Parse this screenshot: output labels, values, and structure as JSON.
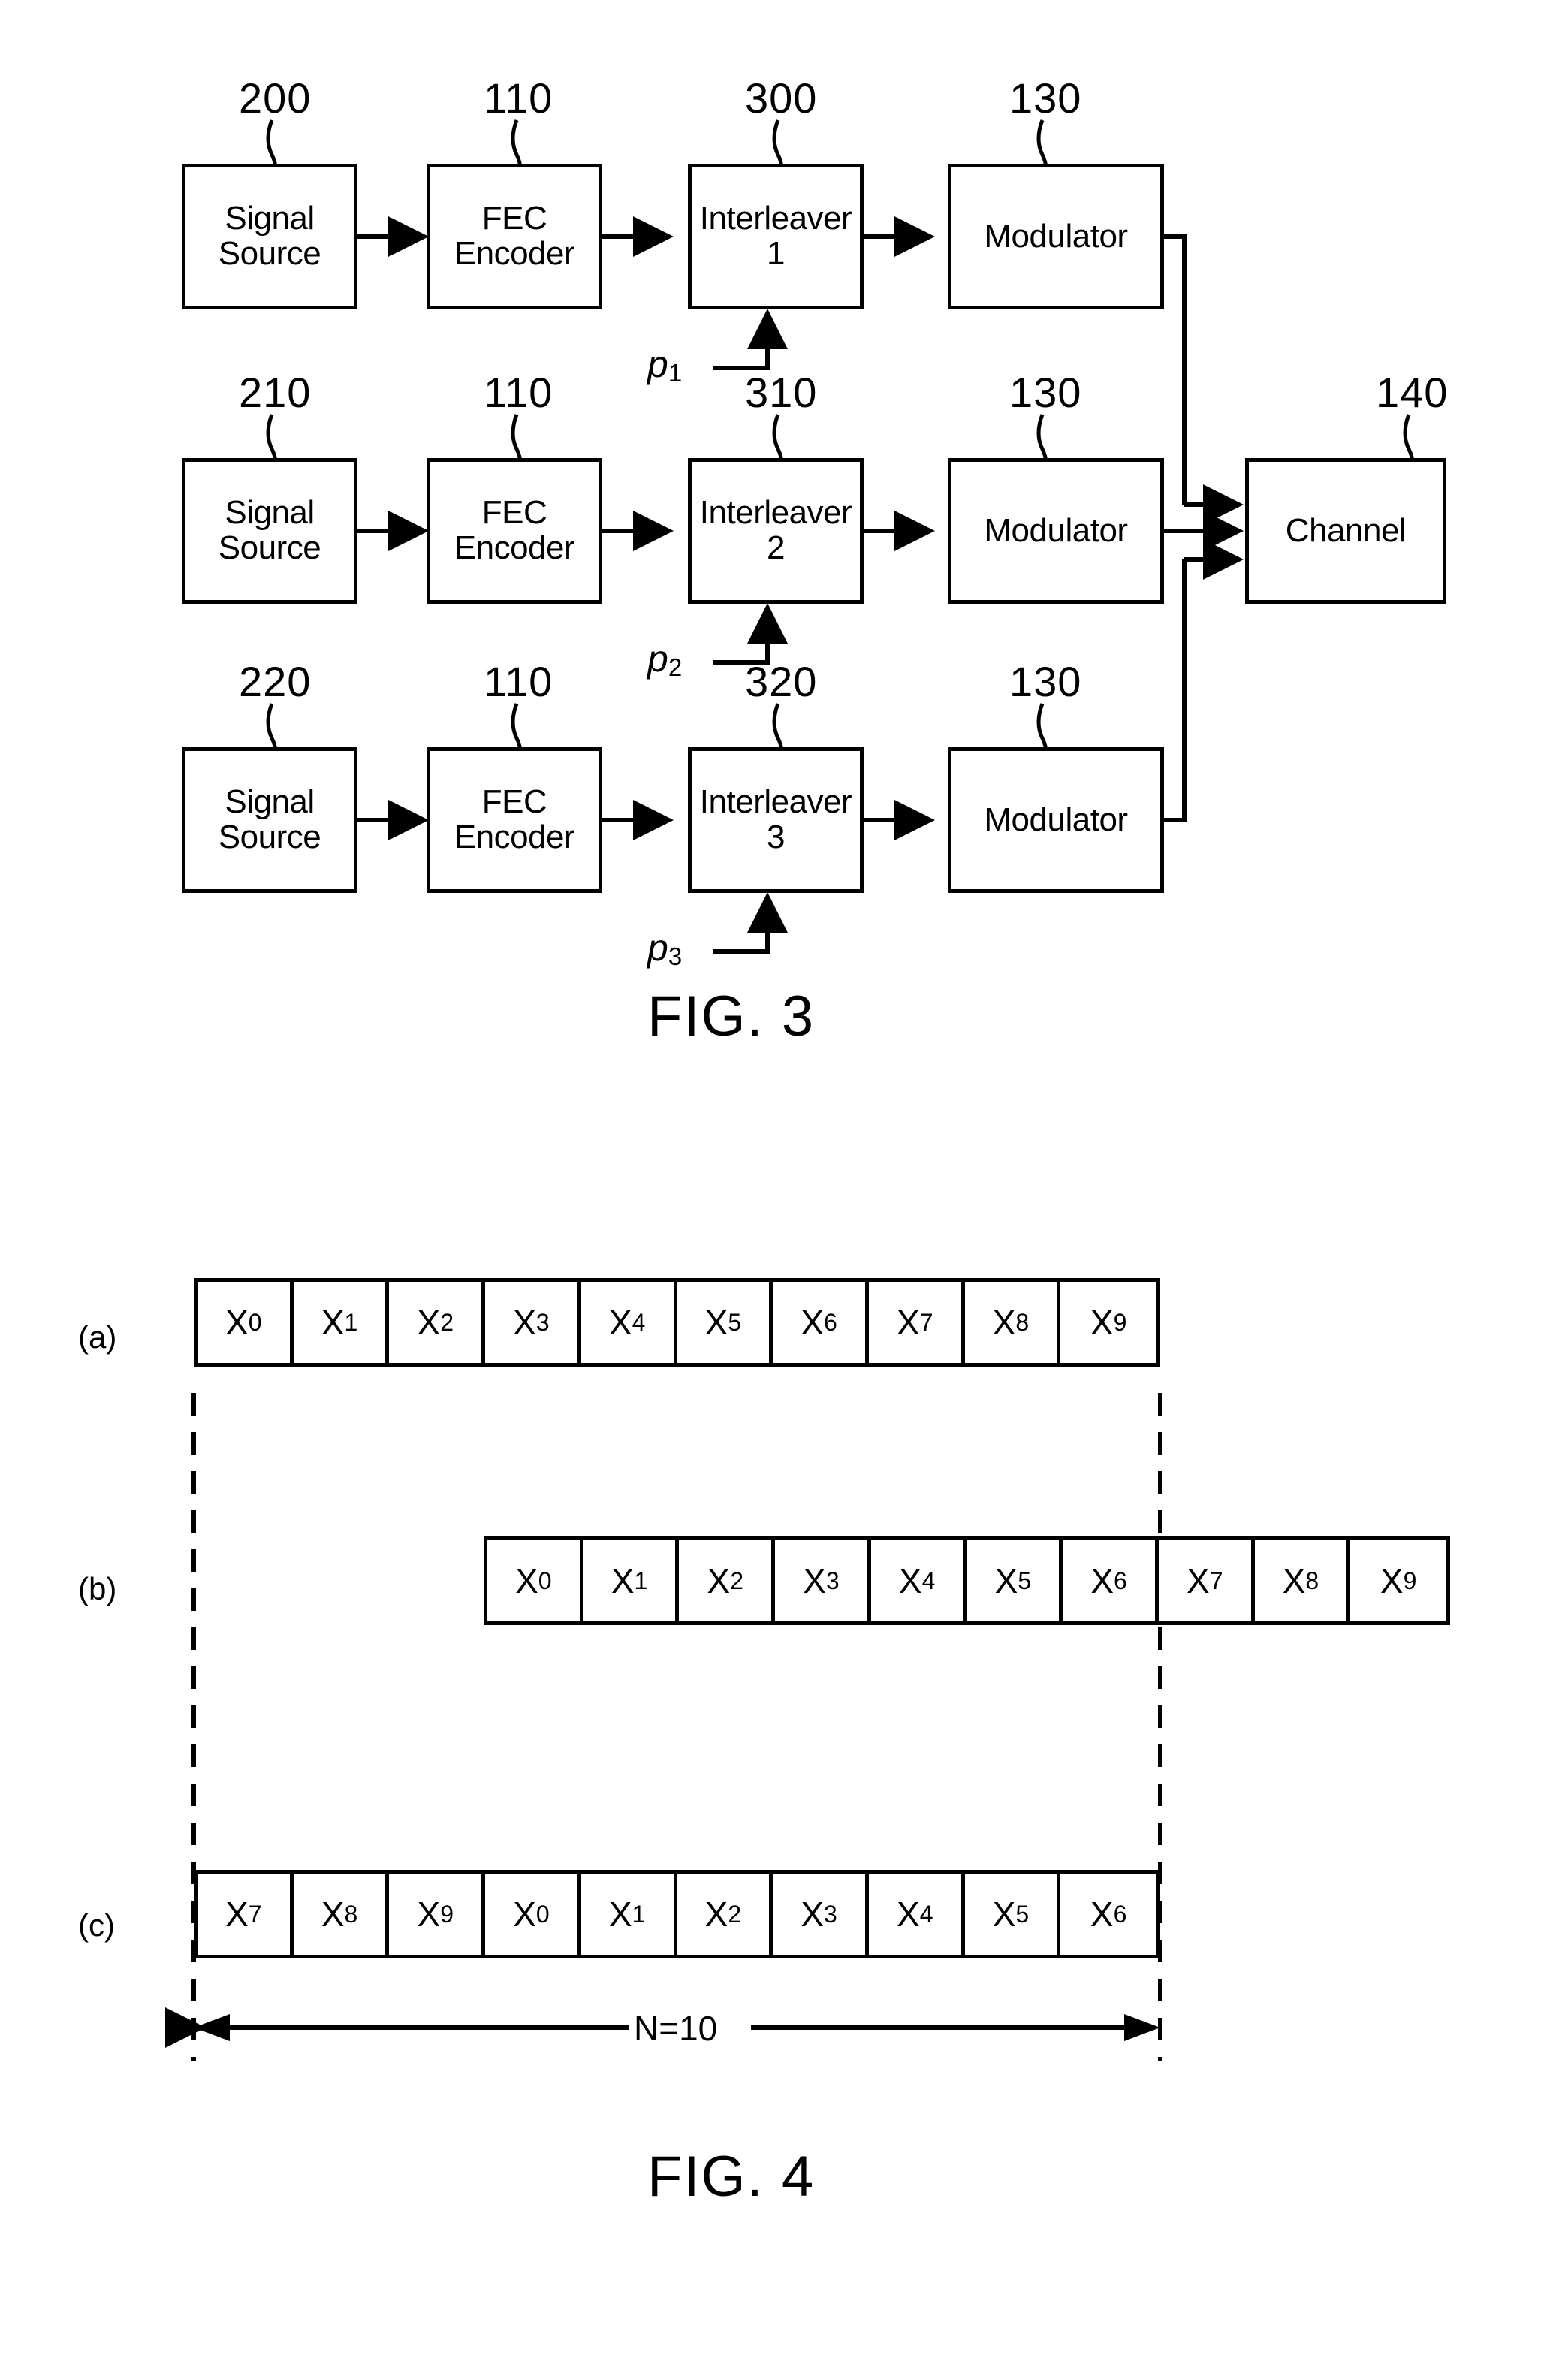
{
  "figure3": {
    "caption": "FIG. 3",
    "rows": [
      {
        "source_ref": "200",
        "source_label_line1": "Signal",
        "source_label_line2": "Source",
        "encoder_ref": "110",
        "encoder_label_line1": "FEC",
        "encoder_label_line2": "Encoder",
        "interleaver_ref": "300",
        "interleaver_label_line1": "Interleaver",
        "interleaver_label_line2": "1",
        "modulator_ref": "130",
        "modulator_label": "Modulator",
        "permutation_label": "p",
        "permutation_sub": "1"
      },
      {
        "source_ref": "210",
        "source_label_line1": "Signal",
        "source_label_line2": "Source",
        "encoder_ref": "110",
        "encoder_label_line1": "FEC",
        "encoder_label_line2": "Encoder",
        "interleaver_ref": "310",
        "interleaver_label_line1": "Interleaver",
        "interleaver_label_line2": "2",
        "modulator_ref": "130",
        "modulator_label": "Modulator",
        "permutation_label": "p",
        "permutation_sub": "2"
      },
      {
        "source_ref": "220",
        "source_label_line1": "Signal",
        "source_label_line2": "Source",
        "encoder_ref": "110",
        "encoder_label_line1": "FEC",
        "encoder_label_line2": "Encoder",
        "interleaver_ref": "320",
        "interleaver_label_line1": "Interleaver",
        "interleaver_label_line2": "3",
        "modulator_ref": "130",
        "modulator_label": "Modulator",
        "permutation_label": "p",
        "permutation_sub": "3"
      }
    ],
    "channel_ref": "140",
    "channel_label": "Channel"
  },
  "figure4": {
    "caption": "FIG. 4",
    "dimension_label": "N=10",
    "symbol_base": "X",
    "rows": [
      {
        "label": "(a)",
        "symbols": [
          "0",
          "1",
          "2",
          "3",
          "4",
          "5",
          "6",
          "7",
          "8",
          "9"
        ]
      },
      {
        "label": "(b)",
        "symbols": [
          "0",
          "1",
          "2",
          "3",
          "4",
          "5",
          "6",
          "7",
          "8",
          "9"
        ]
      },
      {
        "label": "(c)",
        "symbols": [
          "7",
          "8",
          "9",
          "0",
          "1",
          "2",
          "3",
          "4",
          "5",
          "6"
        ]
      }
    ]
  }
}
